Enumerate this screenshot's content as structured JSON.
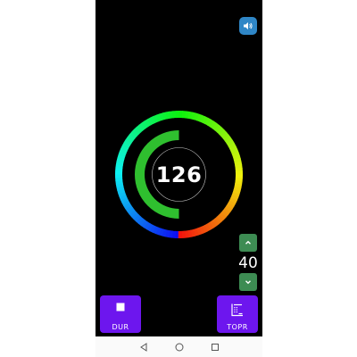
{
  "header": {
    "speaker_icon": "speaker-icon"
  },
  "meter": {
    "reading": "126",
    "inner_arc_fraction": 0.5
  },
  "stepper": {
    "value": "40",
    "up_icon": "chevron-up-icon",
    "down_icon": "chevron-down-icon"
  },
  "actions": [
    {
      "label": "DUR",
      "icon": "stop-icon"
    },
    {
      "label": "TOPR",
      "icon": "list-icon"
    }
  ],
  "navbar": {
    "back_icon": "back-icon",
    "home_icon": "home-icon",
    "recent_icon": "recent-apps-icon"
  },
  "colors": {
    "inner_arc": "#2fbf2f",
    "speaker_button": "#2f86c6",
    "stepper_button": "#3d8c53",
    "action_button": "#6d16ee"
  }
}
